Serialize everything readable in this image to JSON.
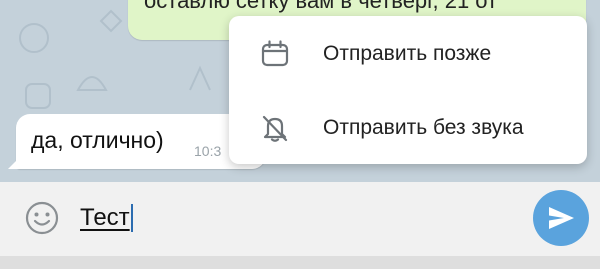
{
  "chat": {
    "outgoing_message_text": "оставлю сетку вам в четверг, 21 от",
    "incoming_message_text": "да, отлично)",
    "incoming_message_time": "10:3"
  },
  "popup_menu": {
    "items": [
      {
        "label": "Отправить позже",
        "icon": "calendar-icon"
      },
      {
        "label": "Отправить без звука",
        "icon": "bell-off-icon"
      }
    ]
  },
  "input": {
    "value": "Тест",
    "emoji_icon": "smiley-icon",
    "send_icon": "send-arrow-icon"
  },
  "colors": {
    "accent": "#5aa3dd",
    "outgoing_bubble": "#e0f5c8",
    "incoming_bubble": "#ffffff"
  }
}
